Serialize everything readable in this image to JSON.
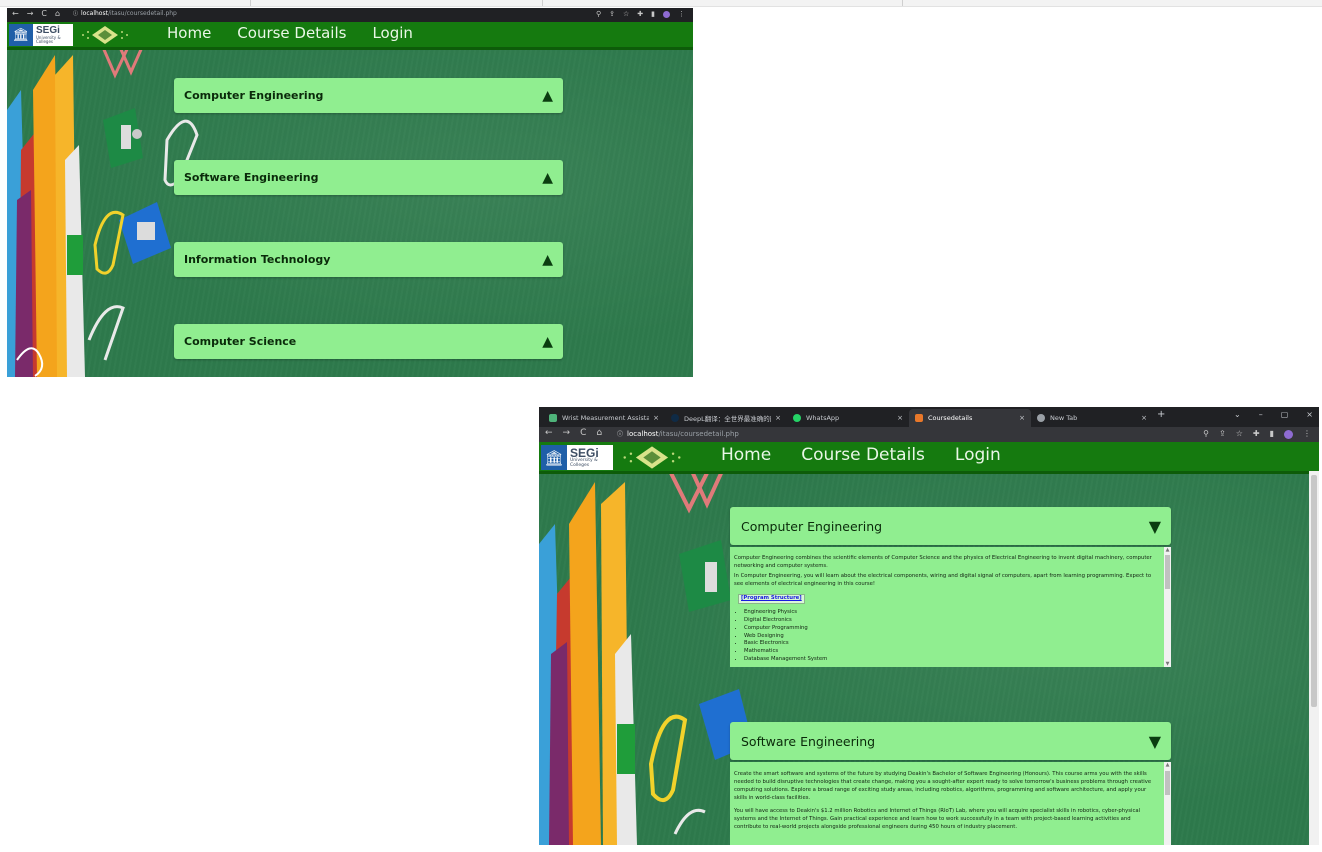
{
  "windows": {
    "collapsed": {
      "address": {
        "host": "localhost",
        "path": "/itasu/coursedetail.php"
      },
      "nav": [
        "Home",
        "Course Details",
        "Login"
      ],
      "logo": {
        "name": "SEGi",
        "line1": "University &",
        "line2": "Colleges"
      },
      "courses": [
        "Computer Engineering",
        "Software Engineering",
        "Information Technology",
        "Computer Science"
      ],
      "arrow": "▲"
    },
    "expanded": {
      "tabs": [
        {
          "label": "Wrist Measurement Assistance.",
          "icon_color": "#4fb37a",
          "active": false
        },
        {
          "label": "DeepL翻译：全世界最准确的翻",
          "icon_color": "#0f2b46",
          "active": false
        },
        {
          "label": "WhatsApp",
          "icon_color": "#25d366",
          "active": false
        },
        {
          "label": "Coursedetails",
          "icon_color": "#e8782a",
          "active": true
        },
        {
          "label": "New Tab",
          "icon_color": "#9aa0a6",
          "active": false
        }
      ],
      "address": {
        "host": "localhost",
        "path": "/itasu/coursedetail.php"
      },
      "nav": [
        "Home",
        "Course Details",
        "Login"
      ],
      "logo": {
        "name": "SEGi",
        "line1": "University &",
        "line2": "Colleges"
      },
      "arrow": "▼",
      "sections": [
        {
          "title": "Computer Engineering",
          "intro": "Computer Engineering combines the scientific elements of Computer Science and the physics of Electrical Engineering to invent digital machinery, computer networking and computer systems.",
          "intro2": "In Computer Engineering, you will learn about the electrical components, wiring and digital signal of computers, apart from learning programming. Expect to see elements of electrical engineering in this course!",
          "program_label": "[Program Structure]",
          "subjects": [
            "Engineering Physics",
            "Digital Electronics",
            "Computer Programming",
            "Web Designing",
            "Basic Electronics",
            "Mathematics",
            "Database Management System"
          ]
        },
        {
          "title": "Software Engineering",
          "intro": "Create the smart software and systems of the future by studying Deakin's Bachelor of Software Engineering (Honours). This course arms you with the skills needed to build disruptive technologies that create change, making you a sought-after expert ready to solve tomorrow's business problems through creative computing solutions. Explore a broad range of exciting study areas, including robotics, algorithms, programming and software architecture, and apply your skills in world-class facilities.",
          "intro2": "You will have access to Deakin's $1.2 million Robotics and Internet of Things (RIoT) Lab, where you will acquire specialist skills in robotics, cyber-physical systems and the Internet of Things. Gain practical experience and learn how to work successfully in a team with project-based learning activities and contribute to real-world projects alongside professional engineers during 450 hours of industry placement."
        }
      ]
    }
  },
  "icons": {
    "back": "←",
    "forward": "→",
    "reload": "C",
    "home": "⌂",
    "close": "×",
    "newtab": "+",
    "minimize": "–",
    "restore": "▢"
  },
  "colors": {
    "accordion": "#90ee90",
    "navbar": "#157a0f",
    "board": "#2e7a4c"
  }
}
